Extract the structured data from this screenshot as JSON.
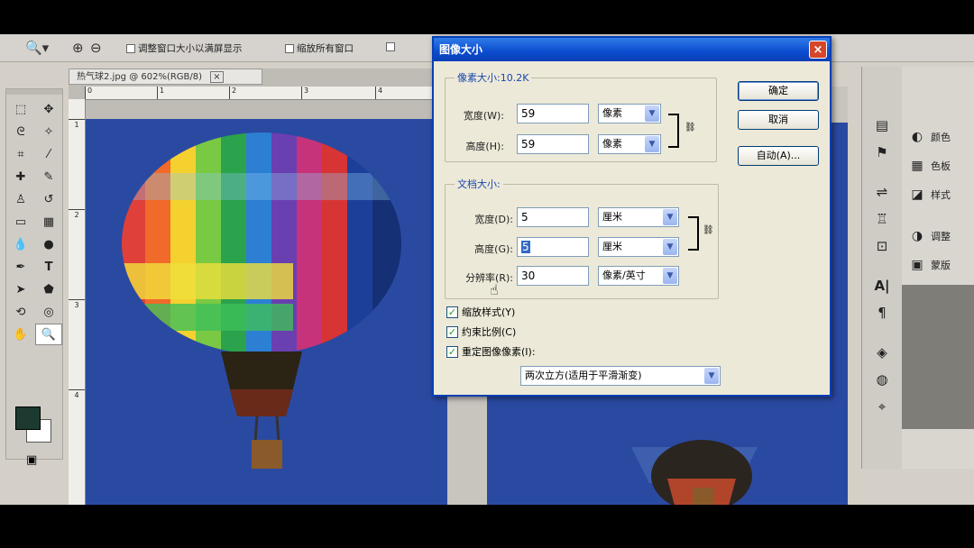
{
  "options_bar": {
    "checkbox1": "调整窗口大小以满屏显示",
    "checkbox2": "缩放所有窗口"
  },
  "document": {
    "tab_title": "热气球2.jpg @ 602%(RGB/8)",
    "close": "×",
    "ruler_h": [
      "0",
      "1",
      "2",
      "3",
      "4"
    ],
    "ruler_v": [
      "1",
      "2",
      "3",
      "4"
    ]
  },
  "dialog": {
    "title": "图像大小",
    "close": "×",
    "pixel_dimensions": {
      "legend": "像素大小:10.2K",
      "width_label": "宽度(W):",
      "width_value": "59",
      "width_unit": "像素",
      "height_label": "高度(H):",
      "height_value": "59",
      "height_unit": "像素"
    },
    "document_size": {
      "legend": "文档大小:",
      "width_label": "宽度(D):",
      "width_value": "5",
      "width_unit": "厘米",
      "height_label": "高度(G):",
      "height_value": "5",
      "height_unit": "厘米",
      "resolution_label": "分辨率(R):",
      "resolution_value": "30",
      "resolution_unit": "像素/英寸"
    },
    "buttons": {
      "ok": "确定",
      "cancel": "取消",
      "auto": "自动(A)..."
    },
    "checkboxes": {
      "scale_styles": "缩放样式(Y)",
      "constrain": "约束比例(C)",
      "resample": "重定图像像素(I):"
    },
    "resample_method": "两次立方(适用于平滑渐变)"
  },
  "panels": {
    "items": [
      {
        "icon": "color-icon",
        "label": "颜色"
      },
      {
        "icon": "swatches-icon",
        "label": "色板"
      },
      {
        "icon": "styles-icon",
        "label": "样式"
      },
      {
        "icon": "adjust-icon",
        "label": "调整"
      },
      {
        "icon": "mask-icon",
        "label": "蒙版"
      }
    ]
  }
}
